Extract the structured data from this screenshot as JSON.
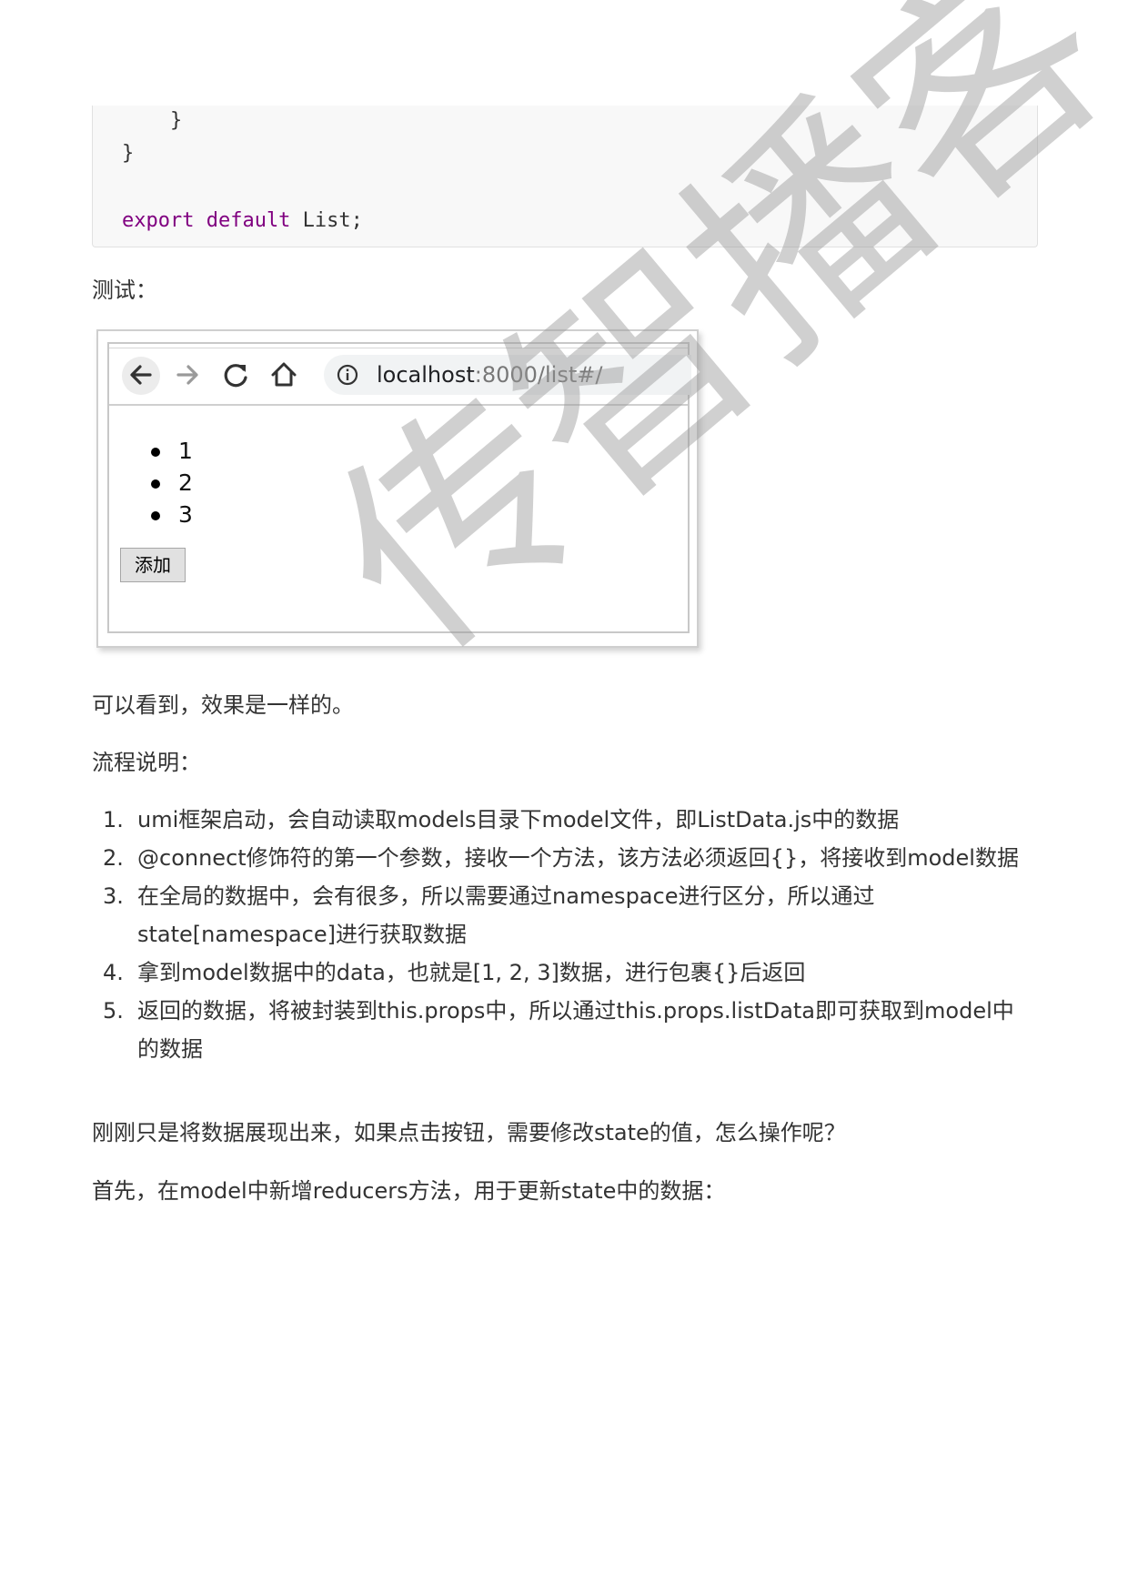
{
  "code": {
    "line1": "    }",
    "line2": "}",
    "line4_keyword": "export default",
    "line4_rest": " List;"
  },
  "test_label": "测试：",
  "screenshot": {
    "url_host": "localhost",
    "url_rest": ":8000/list#/",
    "list_items": [
      "1",
      "2",
      "3"
    ],
    "add_button_label": "添加"
  },
  "effect_text": "可以看到，效果是一样的。",
  "flow_label": "流程说明：",
  "steps": [
    {
      "num": "1.",
      "text": "umi框架启动，会自动读取models目录下model文件，即ListData.js中的数据"
    },
    {
      "num": "2.",
      "text": "@connect修饰符的第一个参数，接收一个方法，该方法必须返回{}，将接收到model数据"
    },
    {
      "num": "3.",
      "text": "在全局的数据中，会有很多，所以需要通过namespace进行区分，所以通过state[namespace]进行获取数据"
    },
    {
      "num": "4.",
      "text": "拿到model数据中的data，也就是[1, 2, 3]数据，进行包裹{}后返回"
    },
    {
      "num": "5.",
      "text": "返回的数据，将被封装到this.props中，所以通过this.props.listData即可获取到model中的数据"
    }
  ],
  "question_text": "刚刚只是将数据展现出来，如果点击按钮，需要修改state的值，怎么操作呢？",
  "first_text": "首先，在model中新增reducers方法，用于更新state中的数据：",
  "watermark": "传智播客"
}
